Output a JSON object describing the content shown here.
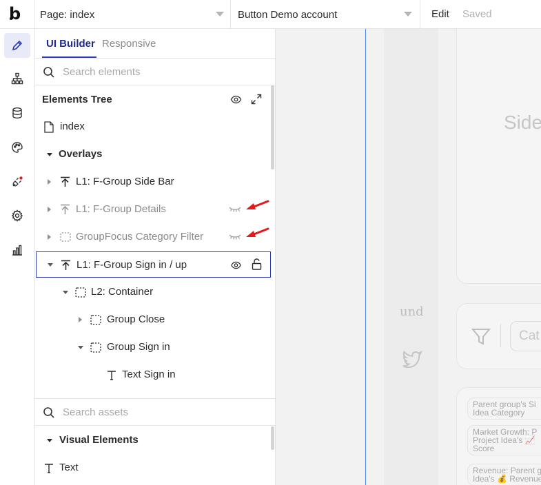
{
  "topbar": {
    "logo": "b",
    "page_select": "Page: index",
    "app_select": "Button Demo account",
    "edit": "Edit",
    "saved": "Saved"
  },
  "rail": {
    "items": [
      {
        "name": "pencil-icon",
        "active": true
      },
      {
        "name": "sitemap-icon"
      },
      {
        "name": "database-icon"
      },
      {
        "name": "palette-icon"
      },
      {
        "name": "plug-icon"
      },
      {
        "name": "gear-icon"
      },
      {
        "name": "bar-chart-icon"
      }
    ]
  },
  "panel": {
    "tabs": [
      "UI Builder",
      "Responsive"
    ],
    "search_elements": "Search elements",
    "tree_title": "Elements Tree",
    "tree": [
      {
        "label": "index"
      },
      {
        "label": "Overlays"
      },
      {
        "label": "L1: F-Group Side Bar"
      },
      {
        "label": "L1: F-Group Details",
        "hidden": true
      },
      {
        "label": "GroupFocus Category Filter",
        "hidden": true
      },
      {
        "label": "L1: F-Group Sign in / up",
        "selected": true
      },
      {
        "label": "L2: Container"
      },
      {
        "label": "Group Close"
      },
      {
        "label": "Group Sign in"
      },
      {
        "label": "Text Sign in"
      }
    ],
    "search_assets": "Search assets",
    "visual_title": "Visual Elements",
    "visual_items": [
      "Text"
    ]
  },
  "canvas": {
    "side_text": "Side",
    "und_text": "und",
    "cat_text": "Cat",
    "chips": [
      "Parent group's Si\nIdea Category",
      "Market Growth: P\nProject Idea's 📈\nScore",
      "Revenue: Parent g\nIdea's 💰 Revenue"
    ]
  },
  "colors": {
    "accent": "#2a3bb0",
    "annotation_arrow": "#e21b1b"
  }
}
